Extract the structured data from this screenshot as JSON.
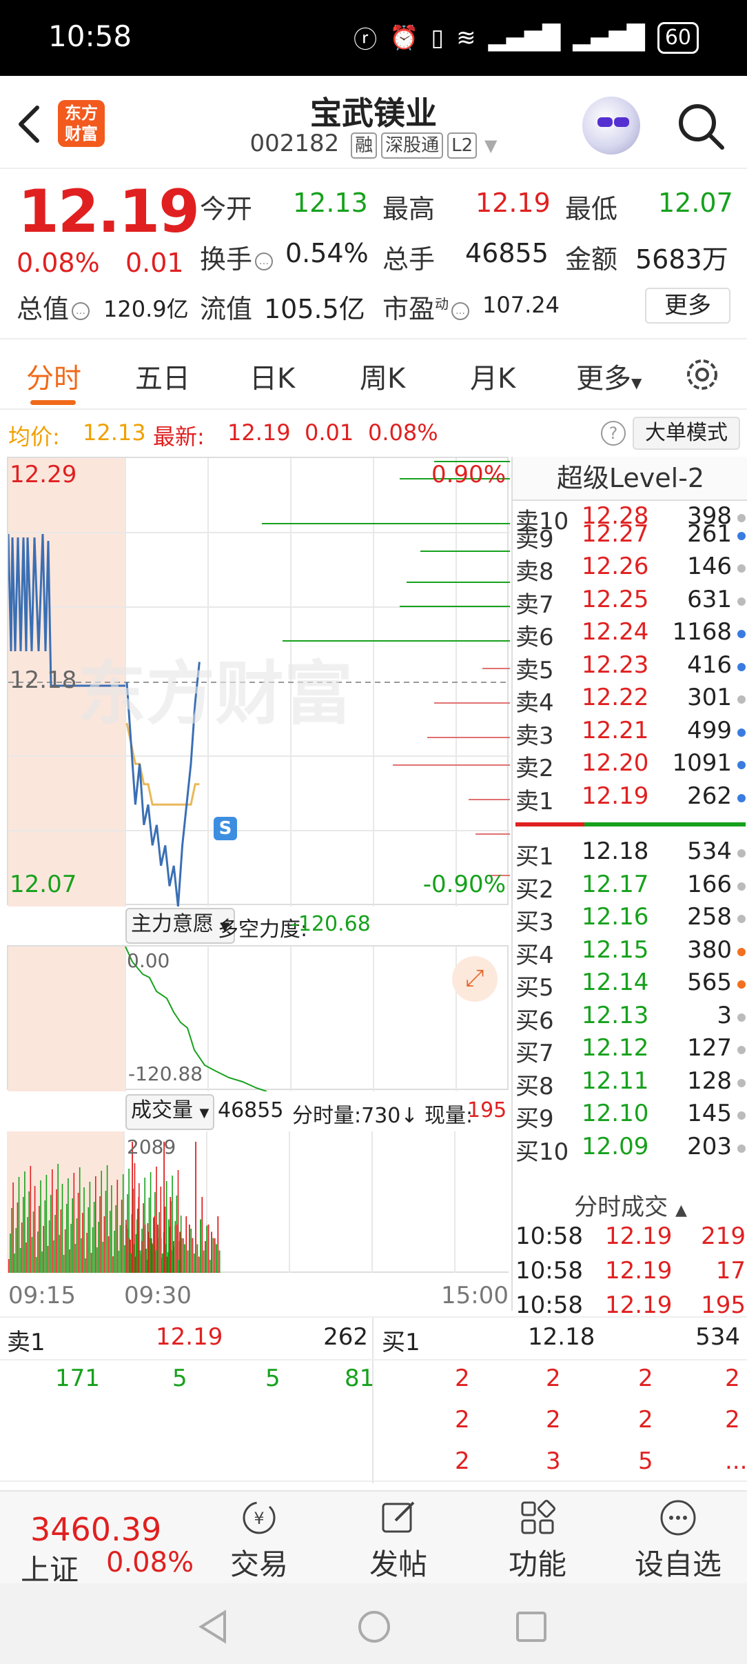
{
  "status_bar": {
    "time": "10:58",
    "battery": "60"
  },
  "header": {
    "app_logo": "东方\n财富",
    "stock_name": "宝武镁业",
    "stock_code": "002182",
    "tags": [
      "融",
      "深股通",
      "L2"
    ]
  },
  "quote": {
    "price": "12.19",
    "change_pct": "0.08%",
    "change": "0.01",
    "open_label": "今开",
    "open": "12.13",
    "high_label": "最高",
    "high": "12.19",
    "low_label": "最低",
    "low": "12.07",
    "turnover_label": "换手",
    "turnover": "0.54%",
    "volume_label": "总手",
    "volume": "46855",
    "amount_label": "金额",
    "amount": "5683万",
    "mktcap_label": "总值",
    "mktcap": "120.9亿",
    "float_label": "流值",
    "float_cap": "105.5亿",
    "pe_label": "市盈",
    "pe_sup": "动",
    "pe": "107.24",
    "more_label": "更多"
  },
  "tabs": [
    "分时",
    "五日",
    "日K",
    "周K",
    "月K",
    "更多"
  ],
  "avg_bar": {
    "avg_label": "均价:",
    "avg_value": "12.13",
    "latest_label": "最新:",
    "latest_value": "12.19",
    "change": "0.01",
    "change_pct": "0.08%",
    "big_order_mode": "大单模式"
  },
  "chart": {
    "y_top": "12.29",
    "y_mid": "12.18",
    "y_bottom": "12.07",
    "pct_top": "0.90%",
    "pct_bottom": "-0.90%",
    "watermark": "东方财富",
    "marker": "S",
    "mainforce_label": "主力意愿",
    "force_label": "多空力度:",
    "force_value": "-120.68",
    "force_top": "0.00",
    "force_bottom": "-120.88",
    "volume_label": "成交量",
    "volume_value": "46855",
    "tick_volume_label": "分时量:730↓",
    "current_volume_label": "现量:",
    "current_volume_value": "195",
    "volume_max": "2089",
    "time_start": "09:15",
    "time_open": "09:30",
    "time_end": "15:00"
  },
  "chart_data": {
    "type": "line",
    "title": "",
    "xlabel": "",
    "ylabel": "",
    "x_ticks": [
      "09:15",
      "09:30",
      "15:00"
    ],
    "ylim": [
      12.07,
      12.29
    ],
    "series": [
      {
        "values": [
          12.18,
          12.15,
          12.12,
          12.14,
          12.11,
          12.12,
          12.1,
          12.11,
          12.09,
          12.1,
          12.08,
          12.09,
          12.07,
          12.1,
          12.12,
          12.14,
          12.17,
          12.19
        ]
      },
      {
        "values": [
          12.16,
          12.15,
          12.14,
          12.14,
          12.13,
          12.13,
          12.12,
          12.12,
          12.12,
          12.12,
          12.12,
          12.12,
          12.12,
          12.12,
          12.12,
          12.12,
          12.13,
          12.13
        ]
      }
    ]
  },
  "orderbook": {
    "title": "超级Level-2",
    "asks": [
      {
        "label": "卖10",
        "price": "12.28",
        "vol": "398"
      },
      {
        "label": "卖9",
        "price": "12.27",
        "vol": "261"
      },
      {
        "label": "卖8",
        "price": "12.26",
        "vol": "146"
      },
      {
        "label": "卖7",
        "price": "12.25",
        "vol": "631"
      },
      {
        "label": "卖6",
        "price": "12.24",
        "vol": "1168"
      },
      {
        "label": "卖5",
        "price": "12.23",
        "vol": "416"
      },
      {
        "label": "卖4",
        "price": "12.22",
        "vol": "301"
      },
      {
        "label": "卖3",
        "price": "12.21",
        "vol": "499"
      },
      {
        "label": "卖2",
        "price": "12.20",
        "vol": "1091"
      },
      {
        "label": "卖1",
        "price": "12.19",
        "vol": "262"
      }
    ],
    "bids": [
      {
        "label": "买1",
        "price": "12.18",
        "vol": "534"
      },
      {
        "label": "买2",
        "price": "12.17",
        "vol": "166"
      },
      {
        "label": "买3",
        "price": "12.16",
        "vol": "258"
      },
      {
        "label": "买4",
        "price": "12.15",
        "vol": "380"
      },
      {
        "label": "买5",
        "price": "12.14",
        "vol": "565"
      },
      {
        "label": "买6",
        "price": "12.13",
        "vol": "3"
      },
      {
        "label": "买7",
        "price": "12.12",
        "vol": "127"
      },
      {
        "label": "买8",
        "price": "12.11",
        "vol": "128"
      },
      {
        "label": "买9",
        "price": "12.10",
        "vol": "145"
      },
      {
        "label": "买10",
        "price": "12.09",
        "vol": "203"
      }
    ],
    "ticks_title": "分时成交",
    "ticks": [
      {
        "time": "10:58",
        "price": "12.19",
        "vol": "219"
      },
      {
        "time": "10:58",
        "price": "12.19",
        "vol": "17"
      },
      {
        "time": "10:58",
        "price": "12.19",
        "vol": "195"
      }
    ]
  },
  "queue": {
    "sell_label": "卖1",
    "sell_price": "12.19",
    "sell_vol": "262",
    "buy_label": "买1",
    "buy_price": "12.18",
    "buy_vol": "534",
    "sell_orders": [
      "171",
      "5",
      "5",
      "81"
    ],
    "buy_orders": [
      "2",
      "2",
      "2",
      "2",
      "2",
      "2",
      "2",
      "2",
      "2",
      "3",
      "5",
      "..."
    ]
  },
  "bottom_nav": {
    "index_value": "3460.39",
    "index_name": "上证",
    "index_pct": "0.08%",
    "trade": "交易",
    "post": "发帖",
    "functions": "功能",
    "watchlist": "设自选"
  }
}
